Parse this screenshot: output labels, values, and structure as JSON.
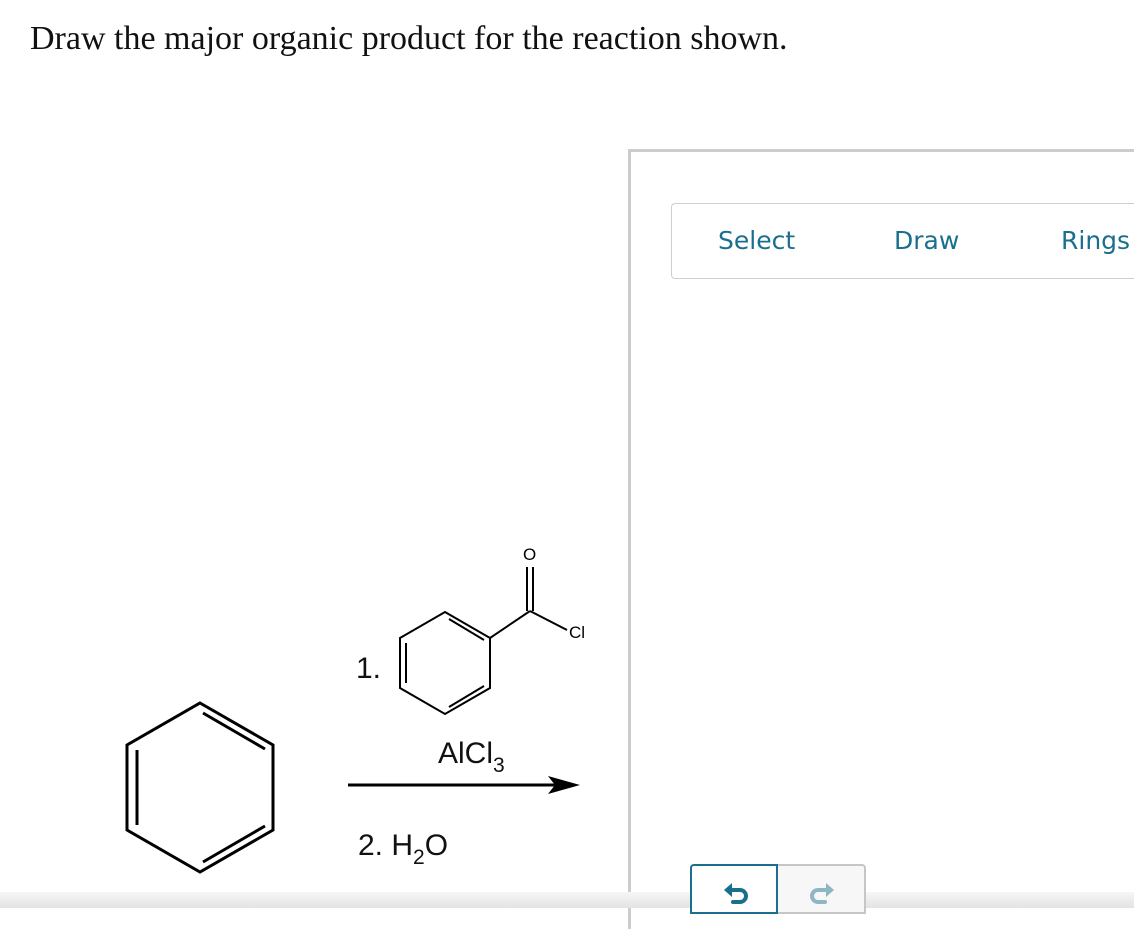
{
  "question": {
    "text": "Draw the major organic product for the reaction shown."
  },
  "reaction": {
    "starting_material": "benzene",
    "step1_label": "1.",
    "reagent_chlorine": "Cl",
    "reagent_oxygen": "O",
    "catalyst": "AlCl",
    "catalyst_sub": "3",
    "step2_prefix": "2. H",
    "step2_sub": "2",
    "step2_suffix": "O"
  },
  "editor": {
    "toolbar": {
      "select_label": "Select",
      "draw_label": "Draw",
      "rings_label": "Rings"
    },
    "undo_icon": "undo-icon",
    "redo_icon": "redo-icon",
    "colors": {
      "accent": "#1a6f8f",
      "border": "#cccccc"
    }
  }
}
